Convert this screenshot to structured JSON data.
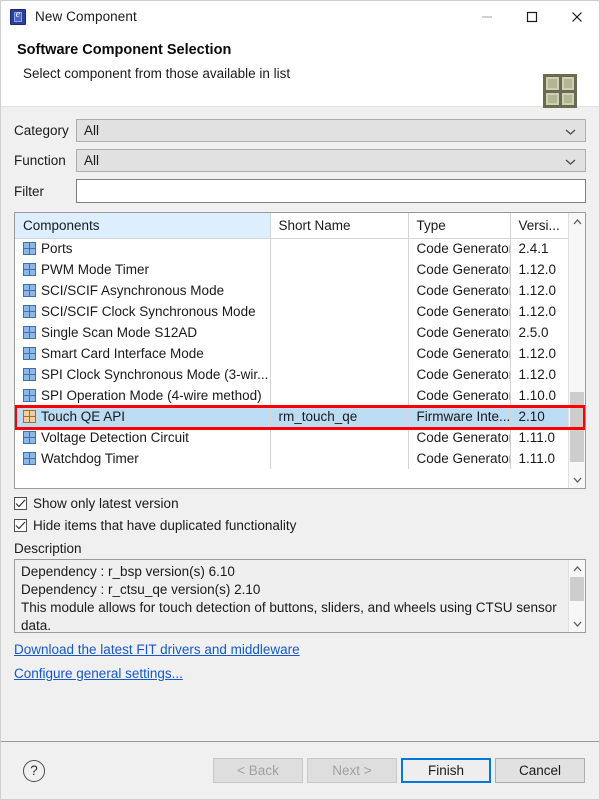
{
  "window": {
    "title": "New Component",
    "icon": "chip-icon",
    "minimize_label": "–",
    "maximize_label": "□",
    "close_label": "✕"
  },
  "header": {
    "title": "Software Component Selection",
    "subtitle": "Select component from those available in list",
    "brand_icon": "grid-logo-icon"
  },
  "filters": {
    "category": {
      "label": "Category",
      "value": "All"
    },
    "function": {
      "label": "Function",
      "value": "All"
    },
    "filter": {
      "label": "Filter",
      "value": "",
      "placeholder": ""
    }
  },
  "table": {
    "columns": [
      "Components",
      "Short Name",
      "Type",
      "Versi..."
    ],
    "sorted_column": "Components",
    "sort_direction": "ascending",
    "rows": [
      {
        "name": "Ports",
        "short_name": "",
        "type": "Code Generator",
        "version": "2.4.1",
        "selected": false
      },
      {
        "name": "PWM Mode Timer",
        "short_name": "",
        "type": "Code Generator",
        "version": "1.12.0",
        "selected": false
      },
      {
        "name": "SCI/SCIF Asynchronous Mode",
        "short_name": "",
        "type": "Code Generator",
        "version": "1.12.0",
        "selected": false
      },
      {
        "name": "SCI/SCIF Clock Synchronous Mode",
        "short_name": "",
        "type": "Code Generator",
        "version": "1.12.0",
        "selected": false
      },
      {
        "name": "Single Scan Mode S12AD",
        "short_name": "",
        "type": "Code Generator",
        "version": "2.5.0",
        "selected": false
      },
      {
        "name": "Smart Card Interface Mode",
        "short_name": "",
        "type": "Code Generator",
        "version": "1.12.0",
        "selected": false
      },
      {
        "name": "SPI Clock Synchronous Mode (3-wir...",
        "short_name": "",
        "type": "Code Generator",
        "version": "1.12.0",
        "selected": false
      },
      {
        "name": "SPI Operation Mode (4-wire method)",
        "short_name": "",
        "type": "Code Generator",
        "version": "1.10.0",
        "selected": false
      },
      {
        "name": "Touch QE API",
        "short_name": "rm_touch_qe",
        "type": "Firmware Inte...",
        "version": "2.10",
        "selected": true
      },
      {
        "name": "Voltage Detection Circuit",
        "short_name": "",
        "type": "Code Generator",
        "version": "1.11.0",
        "selected": false
      },
      {
        "name": "Watchdog Timer",
        "short_name": "",
        "type": "Code Generator",
        "version": "1.11.0",
        "selected": false
      }
    ]
  },
  "options": {
    "show_latest": {
      "label": "Show only latest version",
      "checked": true
    },
    "hide_duplicated": {
      "label": "Hide items that have duplicated functionality",
      "checked": true
    }
  },
  "description": {
    "label": "Description",
    "lines": [
      "Dependency : r_bsp version(s) 6.10",
      "Dependency : r_ctsu_qe version(s) 2.10",
      "This module allows for touch detection of buttons, sliders, and wheels using CTSU sensor",
      "data."
    ]
  },
  "links": {
    "download": "Download the latest FIT drivers and middleware",
    "configure": "Configure general settings..."
  },
  "footer": {
    "help_label": "?",
    "back": {
      "label": "< Back",
      "enabled": false
    },
    "next": {
      "label": "Next >",
      "enabled": false
    },
    "finish": {
      "label": "Finish",
      "enabled": true,
      "focused": true
    },
    "cancel": {
      "label": "Cancel",
      "enabled": true
    }
  },
  "annotation": {
    "color": "#ff0000",
    "target": "Touch QE API"
  }
}
